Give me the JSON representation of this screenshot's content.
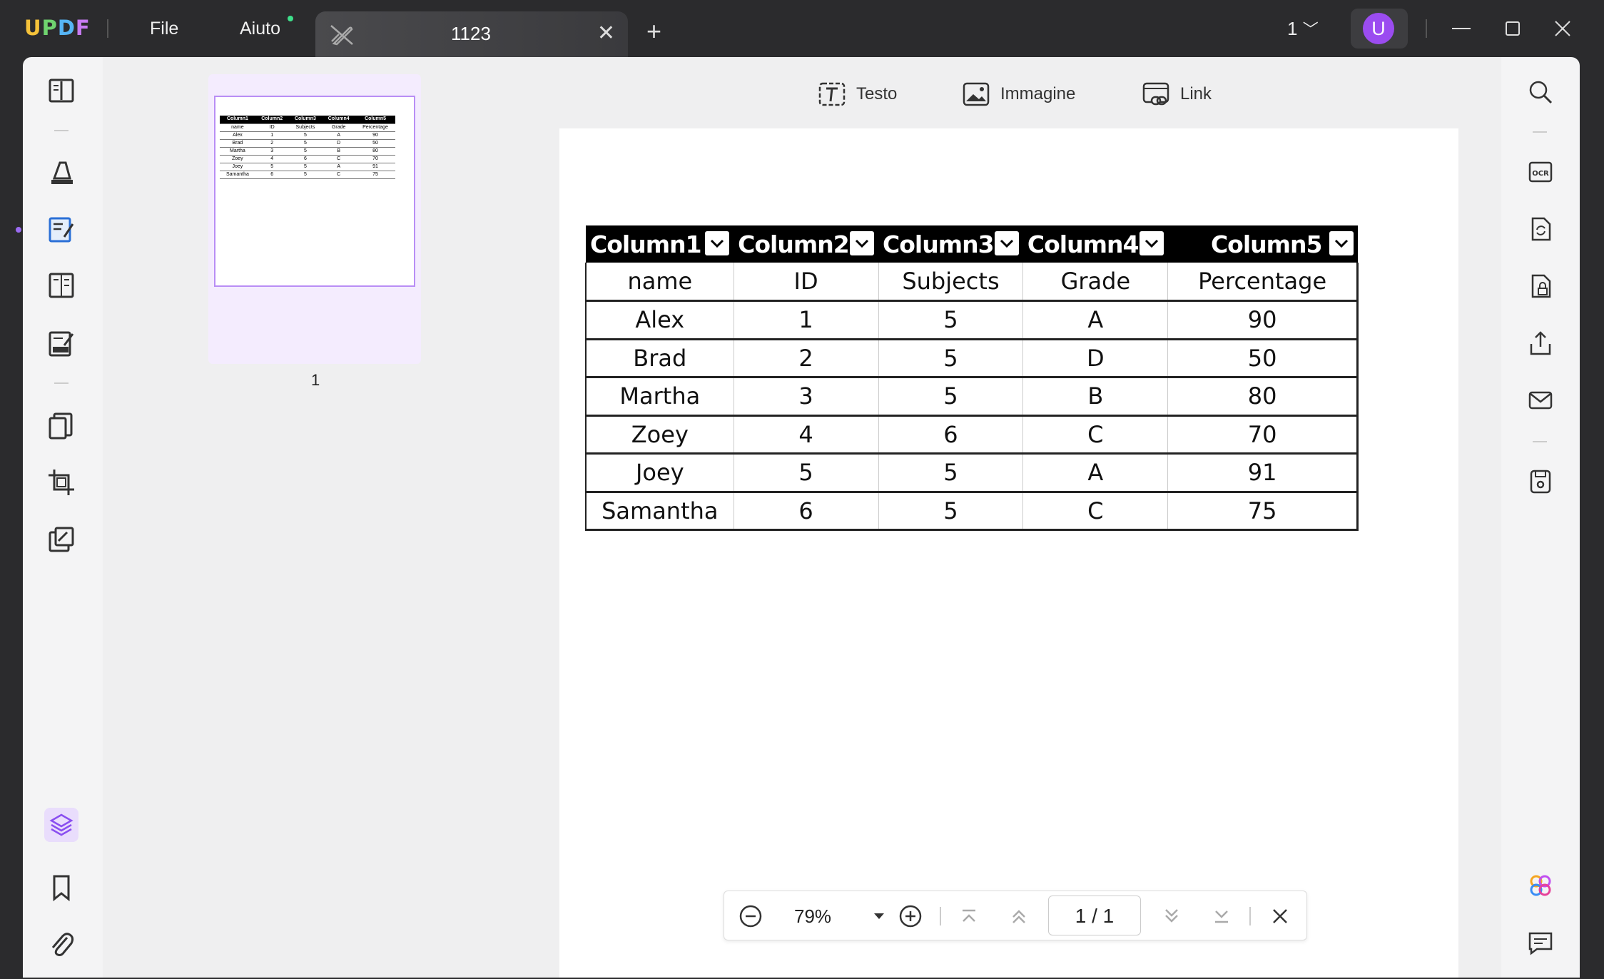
{
  "app": {
    "logo": [
      "U",
      "P",
      "D",
      "F"
    ],
    "menu": {
      "file": "File",
      "help": "Aiuto"
    },
    "tab": {
      "title": "1123"
    },
    "page_indicator": "1",
    "avatar_letter": "U"
  },
  "thumbnails": {
    "page_label": "1"
  },
  "edit_toolbar": {
    "text": "Testo",
    "image": "Immagine",
    "link": "Link"
  },
  "table": {
    "headers": [
      "Column1",
      "Column2",
      "Column3",
      "Column4",
      "Column5"
    ],
    "rows": [
      [
        "name",
        "ID",
        "Subjects",
        "Grade",
        "Percentage"
      ],
      [
        "Alex",
        "1",
        "5",
        "A",
        "90"
      ],
      [
        "Brad",
        "2",
        "5",
        "D",
        "50"
      ],
      [
        "Martha",
        "3",
        "5",
        "B",
        "80"
      ],
      [
        "Zoey",
        "4",
        "6",
        "C",
        "70"
      ],
      [
        "Joey",
        "5",
        "5",
        "A",
        "91"
      ],
      [
        "Samantha",
        "6",
        "5",
        "C",
        "75"
      ]
    ]
  },
  "zoom": {
    "level": "79%",
    "page": "1 / 1"
  },
  "colors": {
    "accent": "#9b4cf0",
    "titlebar": "#2b2b2d",
    "thumb_border": "#b98ef5"
  }
}
